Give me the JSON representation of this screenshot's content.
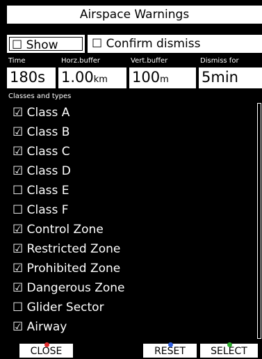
{
  "title": "Airspace Warnings",
  "options": {
    "show_label": "☐ Show",
    "confirm_label": "☐ Confirm dismiss"
  },
  "fields": {
    "time": {
      "label": "Time",
      "value": "180s",
      "unit": ""
    },
    "horz_buffer": {
      "label": "Horz.buffer",
      "value": "1.00",
      "unit": "km"
    },
    "vert_buffer": {
      "label": "Vert.buffer",
      "value": "100",
      "unit": "m"
    },
    "dismiss_for": {
      "label": "Dismiss for",
      "value": "5min",
      "unit": ""
    }
  },
  "list_header": "Classes and types",
  "classes": [
    {
      "label": "☑ Class A",
      "checked": true
    },
    {
      "label": "☑ Class B",
      "checked": true
    },
    {
      "label": "☑ Class C",
      "checked": true
    },
    {
      "label": "☑ Class D",
      "checked": true
    },
    {
      "label": "☐ Class E",
      "checked": false
    },
    {
      "label": "☐ Class F",
      "checked": false
    },
    {
      "label": "☑ Control Zone",
      "checked": true
    },
    {
      "label": "☑ Restricted Zone",
      "checked": true
    },
    {
      "label": "☑ Prohibited Zone",
      "checked": true
    },
    {
      "label": "☑ Dangerous Zone",
      "checked": true
    },
    {
      "label": "☐ Glider Sector",
      "checked": false
    },
    {
      "label": "☑ Airway",
      "checked": true
    }
  ],
  "buttons": {
    "close": {
      "label": "CLOSE",
      "dot_color": "#e03030"
    },
    "reset": {
      "label": "RESET",
      "dot_color": "#3060e0"
    },
    "select": {
      "label": "SELECT",
      "dot_color": "#30b030"
    }
  }
}
